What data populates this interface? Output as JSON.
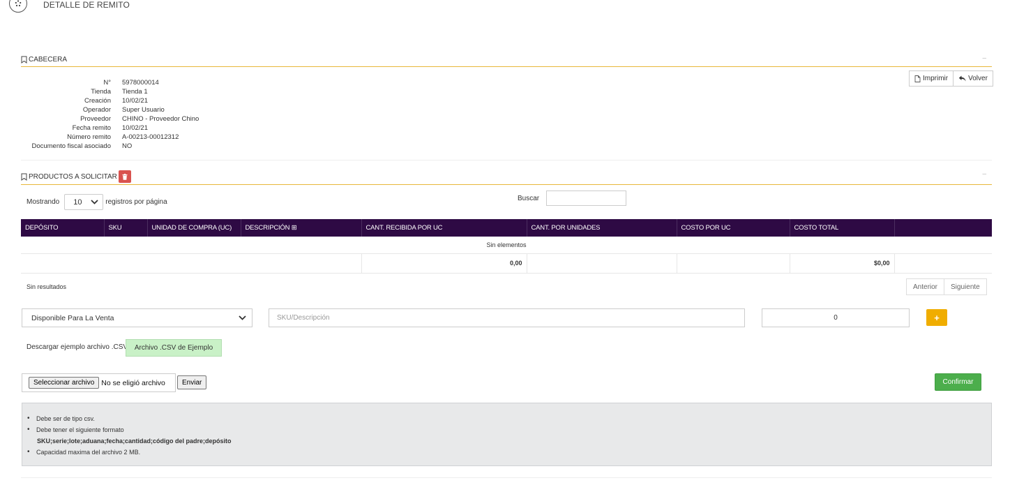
{
  "header": {
    "title": "DETALLE DE REMITO",
    "icon": "grid-dots-icon"
  },
  "cabecera": {
    "title": "CABECERA",
    "collapse": "–",
    "buttons": {
      "print": "Imprimir",
      "back": "Volver"
    },
    "fields": [
      {
        "label": "N°",
        "value": "5978000014"
      },
      {
        "label": "Tienda",
        "value": "Tienda 1"
      },
      {
        "label": "Creación",
        "value": "10/02/21"
      },
      {
        "label": "Operador",
        "value": "Super Usuario"
      },
      {
        "label": "Proveedor",
        "value": "CHINO - Proveedor Chino"
      },
      {
        "label": "Fecha remito",
        "value": "10/02/21"
      },
      {
        "label": "Número remito",
        "value": "A-00213-00012312"
      },
      {
        "label": "Documento fiscal asociado",
        "value": "NO"
      }
    ]
  },
  "productos": {
    "title": "PRODUCTOS A SOLICITAR",
    "collapse": "–",
    "length": {
      "prefix": "Mostrando",
      "value": "10",
      "suffix": "registros por página"
    },
    "search": {
      "label": "Buscar",
      "value": ""
    },
    "columns": [
      "DEPÓSITO",
      "SKU",
      "UNIDAD DE COMPRA (UC)",
      "DESCRIPCIÓN ⊞",
      "CANT. RECIBIDA POR UC",
      "CANT. POR UNIDADES",
      "COSTO POR UC",
      "COSTO TOTAL",
      ""
    ],
    "empty_text": "Sin elementos",
    "totals": {
      "cant_recibida": "0,00",
      "costo_total": "$0,00"
    },
    "info": "Sin resultados",
    "pager": {
      "prev": "Anterior",
      "next": "Siguiente"
    }
  },
  "add_form": {
    "deposit_selected": "Disponible Para La Venta",
    "sku_placeholder": "SKU/Descripción",
    "quantity": "0",
    "add_label": "+"
  },
  "csv": {
    "label": "Descargar ejemplo archivo .CSV",
    "example_button": "Archivo .CSV de Ejemplo",
    "file_button": "Seleccionar archivo",
    "file_status": "No se eligió archivo",
    "send_button": "Enviar",
    "confirm_button": "Confirmar"
  },
  "notes": {
    "items": [
      "Debe ser de tipo csv.",
      "Debe tener el siguiente formato",
      "SKU;serie;lote;aduana;fecha;cantidad;código del padre;depósito",
      "Capacidad maxima del archivo 2 MB."
    ]
  },
  "colors": {
    "accent": "#e8b73a",
    "table_header": "#2e0a44",
    "danger": "#d9534f",
    "warning": "#f0ad00",
    "success": "#4cae4c"
  }
}
